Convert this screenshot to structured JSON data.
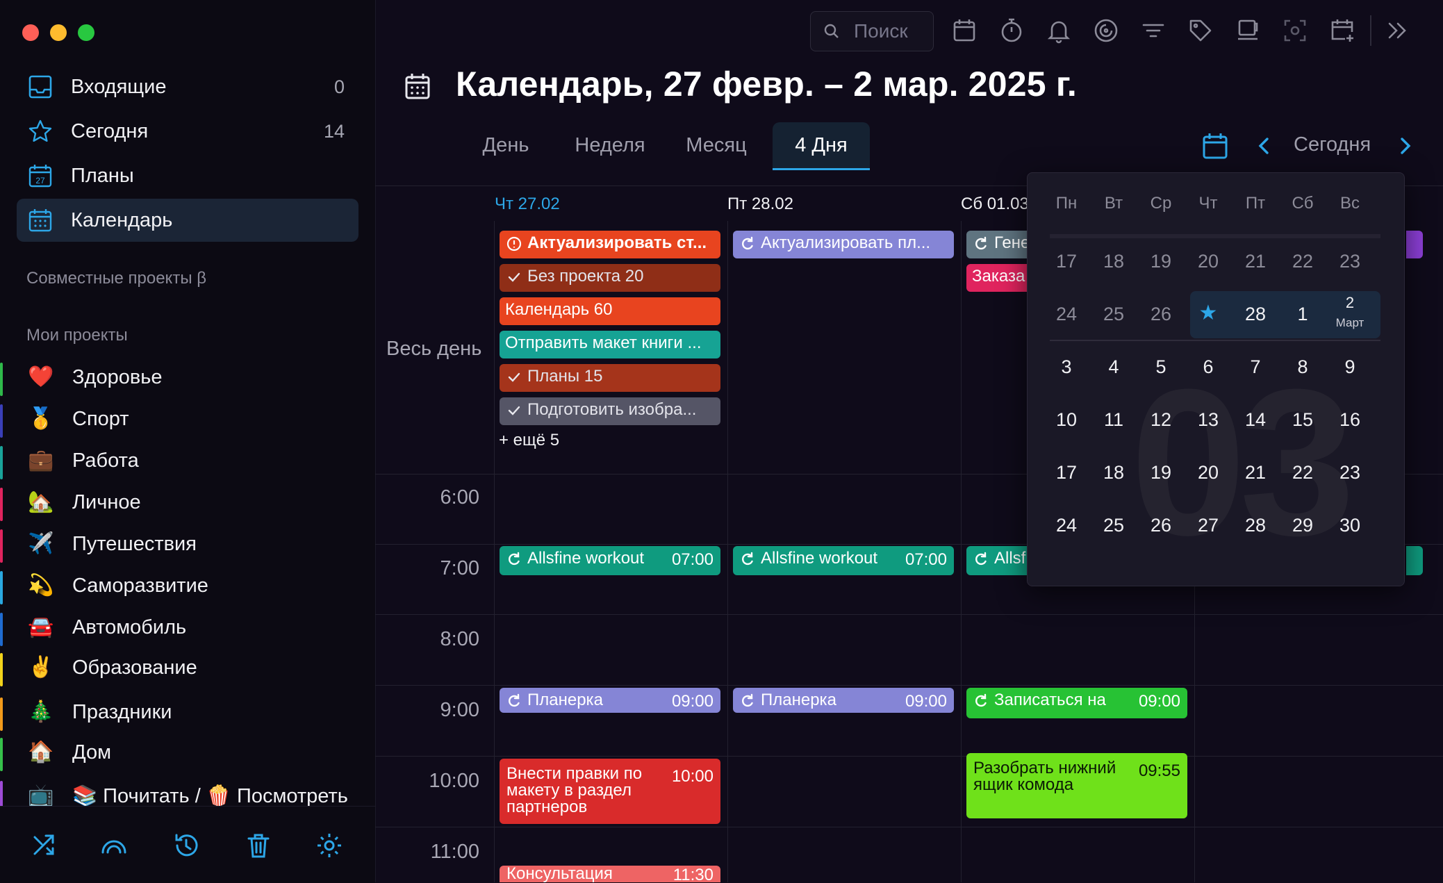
{
  "window_controls": {
    "close_color": "#fe5f57",
    "minimize_color": "#febc2e",
    "maximize_color": "#28c840"
  },
  "sidebar": {
    "items": [
      {
        "label": "Входящие",
        "count": "0",
        "icon": "inbox-icon"
      },
      {
        "label": "Сегодня",
        "count": "14",
        "icon": "star-icon"
      },
      {
        "label": "Планы",
        "count": "",
        "icon": "plans-calendar-icon",
        "icon_text": "27"
      },
      {
        "label": "Календарь",
        "count": "",
        "icon": "calendar-grid-icon"
      }
    ],
    "shared_section": "Совместные проекты β",
    "my_section": "Мои проекты",
    "projects": [
      {
        "emoji": "❤️",
        "label": "Здоровье",
        "color": "#2fb94a"
      },
      {
        "emoji": "🥇",
        "label": "Спорт",
        "color": "#3a3fb8"
      },
      {
        "emoji": "💼",
        "label": "Работа",
        "color": "#1aa39a"
      },
      {
        "emoji": "🏡",
        "label": "Личное",
        "color": "#e0245e"
      },
      {
        "emoji": "✈️",
        "label": "Путешествия",
        "color": "#e0245e"
      },
      {
        "emoji": "💫",
        "label": "Саморазвитие",
        "color": "#2aa8e0"
      },
      {
        "emoji": "🚘",
        "label": "Автомобиль",
        "color": "#1f6bd0"
      },
      {
        "emoji": "✌️",
        "label": "Образование",
        "color": "#f2d21b"
      },
      {
        "emoji": "🎄",
        "label": "Праздники",
        "color": "#f29a1b"
      },
      {
        "emoji": "🏠",
        "label": "Дом",
        "color": "#36c04a"
      },
      {
        "emoji": "📺",
        "label": "📚 Почитать / 🍿 Посмотреть",
        "color": "#9e4bd6"
      }
    ],
    "footer_icons": [
      "shuffle-icon",
      "rainbow-icon",
      "history-icon",
      "trash-icon",
      "settings-gear-icon"
    ]
  },
  "toolbar": {
    "search_placeholder": "Поиск",
    "icons": [
      "calendar-icon",
      "timer-icon",
      "bell-icon",
      "focus-icon",
      "filter-icon",
      "tag-icon",
      "coffee-icon",
      "scan-icon",
      "add-calendar-icon",
      "expand-icon"
    ]
  },
  "header": {
    "title": "Календарь, 27 февр. – 2 мар. 2025 г.",
    "tabs": [
      "День",
      "Неделя",
      "Месяц",
      "4 Дня"
    ],
    "active_tab": "4 Дня",
    "today_label": "Сегодня"
  },
  "grid": {
    "all_day_label": "Весь день",
    "days": [
      "Чт 27.02",
      "Пт 28.02",
      "Сб 01.03"
    ],
    "times": [
      "6:00",
      "7:00",
      "8:00",
      "9:00",
      "10:00",
      "11:00"
    ]
  },
  "allday_events": {
    "d1": [
      {
        "title": "Актуализировать ст...",
        "color": "#e8441f",
        "icon": "alert-icon"
      },
      {
        "title": "Без проекта 20",
        "color": "#8f2e17",
        "icon": "check-icon"
      },
      {
        "title": "Календарь 60",
        "color": "#e8441f",
        "icon": ""
      },
      {
        "title": "Отправить макет книги ...",
        "color": "#16a394",
        "icon": ""
      },
      {
        "title": "Планы 15",
        "color": "#a5341b",
        "icon": "check-icon"
      },
      {
        "title": "Подготовить изобра...",
        "color": "#555566",
        "icon": "check-icon"
      }
    ],
    "more": "+ ещё 5",
    "d2": [
      {
        "title": "Актуализировать пл...",
        "color": "#8585d6",
        "icon": "repeat-icon"
      }
    ],
    "d3": [
      {
        "title": "Гене",
        "color": "#5f7480",
        "icon": "repeat-icon"
      },
      {
        "title": "Заказа",
        "color": "#e0245e",
        "icon": ""
      }
    ]
  },
  "timed_events": {
    "workout": {
      "title": "Allsfine workout",
      "time": "07:00",
      "color": "#0f9b7f"
    },
    "workout_short": "Allsf",
    "meeting": {
      "title": "Планерка",
      "time": "09:00",
      "color": "#8585d6"
    },
    "signup": {
      "title": "Записаться на",
      "time": "09:00",
      "color": "#27c234"
    },
    "edits": {
      "title": "Внести правки по макету в раздел партнеров",
      "time": "10:00",
      "color": "#d92b2b"
    },
    "drawer": {
      "title": "Разобрать нижний ящик комода",
      "time": "09:55",
      "color": "#6fe11a"
    },
    "consult": {
      "title": "Консультация",
      "time": "11:30",
      "color": "#ee6464"
    }
  },
  "minical": {
    "weekdays": [
      "Пн",
      "Вт",
      "Ср",
      "Чт",
      "Пт",
      "Сб",
      "Вс"
    ],
    "rows": [
      [
        "17",
        "18",
        "19",
        "20",
        "21",
        "22",
        "23"
      ],
      [
        "24",
        "25",
        "26",
        "★",
        "28",
        "1",
        "2"
      ],
      [
        "3",
        "4",
        "5",
        "6",
        "7",
        "8",
        "9"
      ],
      [
        "10",
        "11",
        "12",
        "13",
        "14",
        "15",
        "16"
      ],
      [
        "17",
        "18",
        "19",
        "20",
        "21",
        "22",
        "23"
      ],
      [
        "24",
        "25",
        "26",
        "27",
        "28",
        "29",
        "30"
      ]
    ],
    "month_label": "Март",
    "watermark": "03",
    "accent": "#2da7e8"
  }
}
